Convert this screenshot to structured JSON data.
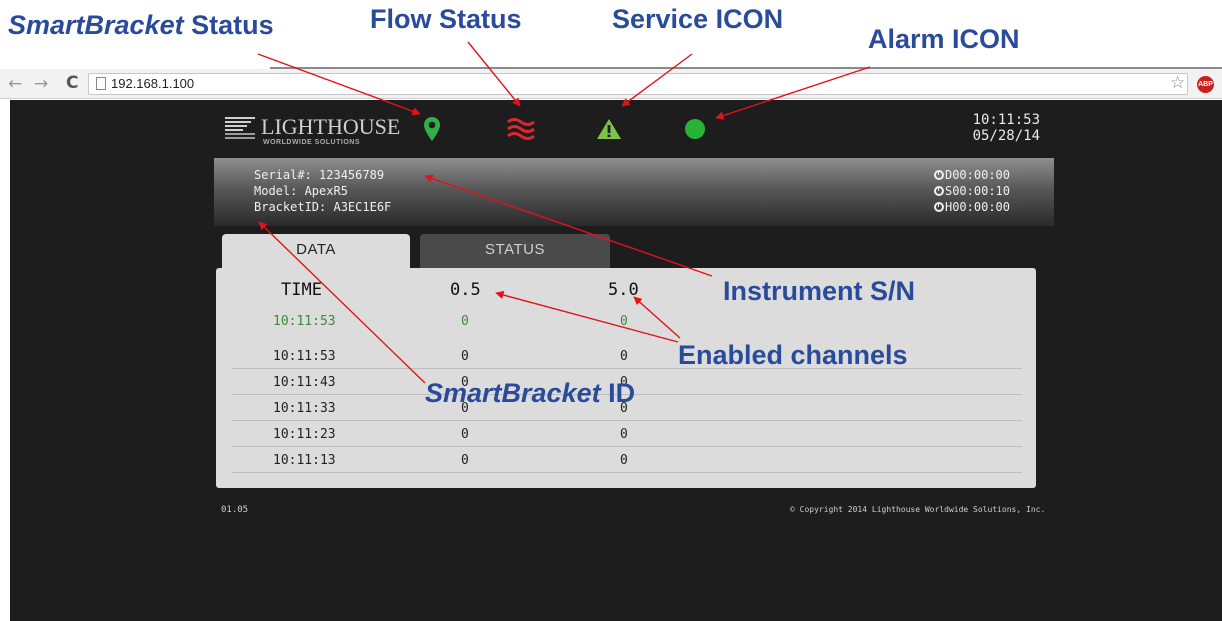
{
  "annotations": {
    "smartbracket_status_italic": "SmartBracket",
    "smartbracket_status_rest": " Status",
    "flow_status": "Flow Status",
    "service_icon": "Service ICON",
    "alarm_icon": "Alarm ICON",
    "instrument_sn": "Instrument S/N",
    "enabled_channels": "Enabled channels",
    "smartbracket_id_italic": "SmartBracket",
    "smartbracket_id_rest": " ID"
  },
  "browser": {
    "back": "←",
    "forward": "→",
    "reload": "C",
    "url": "192.168.1.100",
    "star": "☆",
    "abp": "ABP"
  },
  "header": {
    "logo_title": "LIGHTHOUSE",
    "logo_subtitle": "WORLDWIDE SOLUTIONS",
    "time": "10:11:53",
    "date": "05/28/14",
    "colors": {
      "smartbracket_status": "#2fae4a",
      "flow_status": "#e0262c",
      "service": "#7dc24a",
      "alarm": "#27b436"
    }
  },
  "info": {
    "serial": "Serial#: 123456789",
    "model": "Model: ApexR5",
    "bracket_id": "BracketID: A3EC1E6F",
    "timers": [
      {
        "letter": "D",
        "value": "00:00:00"
      },
      {
        "letter": "S",
        "value": "00:00:10"
      },
      {
        "letter": "H",
        "value": "00:00:00"
      }
    ]
  },
  "tabs": {
    "data": "DATA",
    "status": "STATUS"
  },
  "table": {
    "headers": [
      "TIME",
      "0.5",
      "5.0"
    ],
    "rows": [
      [
        "10:11:53",
        "0",
        "0"
      ],
      [
        "10:11:53",
        "0",
        "0"
      ],
      [
        "10:11:43",
        "0",
        "0"
      ],
      [
        "10:11:33",
        "0",
        "0"
      ],
      [
        "10:11:23",
        "0",
        "0"
      ],
      [
        "10:11:13",
        "0",
        "0"
      ]
    ]
  },
  "footer": {
    "version": "01.05",
    "copyright": "© Copyright 2014 Lighthouse Worldwide Solutions, Inc."
  }
}
